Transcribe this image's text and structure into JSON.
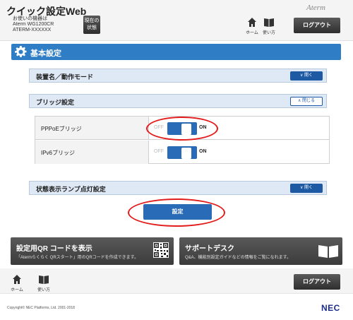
{
  "header": {
    "app_title": "クイック設定Web",
    "model_label": "お使いの機器は",
    "model_name": "Aterm WG1200CR",
    "device_id": "ATERM-XXXXXX",
    "status_button_line1": "現在の",
    "status_button_line2": "状態",
    "brand": "Aterm",
    "nav_home": "ホーム",
    "nav_manual": "使い方",
    "logout": "ログアウト"
  },
  "section": {
    "title": "基本設定"
  },
  "panels": {
    "device_mode": {
      "label": "装置名／動作モード",
      "button": "開く",
      "state": "collapsed"
    },
    "bridge": {
      "label": "ブリッジ設定",
      "button": "閉じる",
      "state": "expanded"
    },
    "status_lamp": {
      "label": "状態表示ランプ点灯設定",
      "button": "開く",
      "state": "collapsed"
    }
  },
  "bridge_settings": [
    {
      "label": "PPPoEブリッジ",
      "off_label": "OFF",
      "on_label": "ON",
      "value": "ON"
    },
    {
      "label": "IPv6ブリッジ",
      "off_label": "OFF",
      "on_label": "ON",
      "value": "ON"
    }
  ],
  "save_button": "設定",
  "cards": {
    "qr": {
      "title": "設定用QR コードを表示",
      "description": "「Atermらくらく QRスタート」用のQRコードを作成できます。"
    },
    "support": {
      "title": "サポートデスク",
      "description": "Q&A、機能別設定ガイドなどの情報をご覧になれます。"
    }
  },
  "footer": {
    "nav_home": "ホーム",
    "nav_manual": "使い方",
    "logout": "ログアウト",
    "copyright": "Copyright© NEC Platforms, Ltd. 2001-2018",
    "logo": "NEC"
  },
  "colors": {
    "accent_blue": "#2f7ec5",
    "button_blue": "#2a6bb8",
    "highlight_red": "#e21b1b",
    "dark_button": "#3b3b3b"
  }
}
